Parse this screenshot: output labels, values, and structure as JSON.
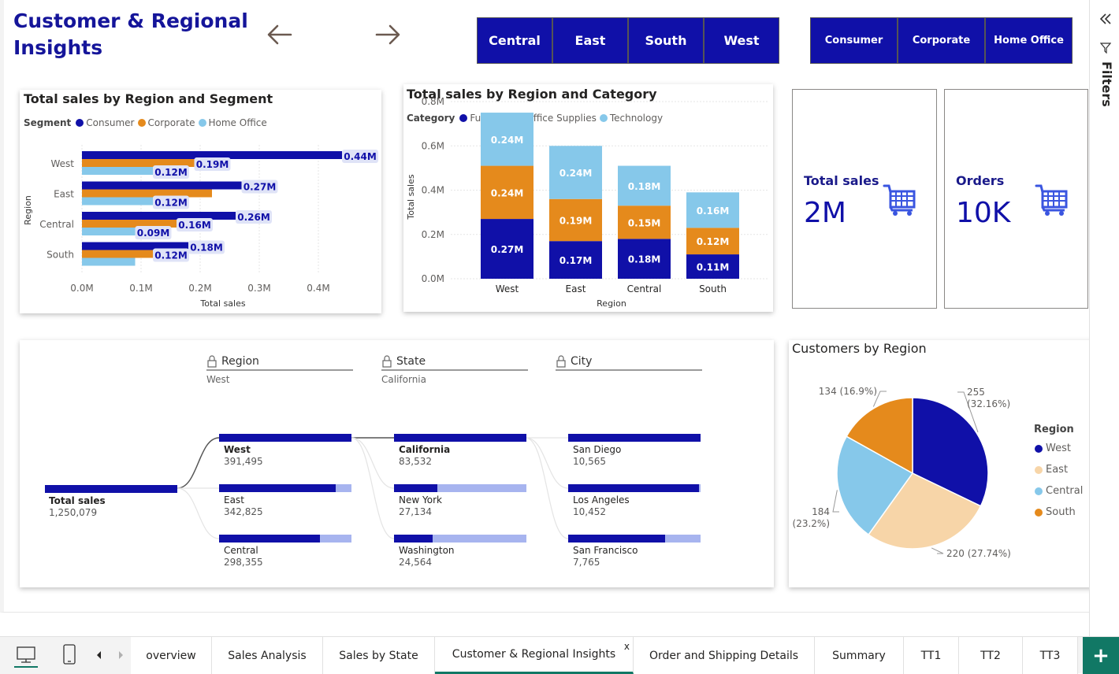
{
  "page": {
    "title": "Customer & Regional Insights"
  },
  "nav": {
    "back": "arrow-left-icon",
    "forward": "arrow-right-icon"
  },
  "region_slicer": [
    "Central",
    "East",
    "South",
    "West"
  ],
  "segment_slicer": [
    "Consumer",
    "Corporate",
    "Home Office"
  ],
  "colors": {
    "navy": "#1010a8",
    "orange": "#e58a1c",
    "light_blue": "#86c8ea",
    "peach": "#f7d5a8",
    "teal_accent": "#117865"
  },
  "segment_chart": {
    "title": "Total sales by Region and Segment",
    "legend_title": "Segment",
    "chart_data": {
      "type": "bar",
      "orientation": "horizontal",
      "categories": [
        "West",
        "East",
        "Central",
        "South"
      ],
      "series": [
        {
          "name": "Consumer",
          "values": [
            0.44,
            0.27,
            0.26,
            0.18
          ],
          "labels": [
            "0.44M",
            "0.27M",
            "0.26M",
            "0.18M"
          ]
        },
        {
          "name": "Corporate",
          "values": [
            0.19,
            0.22,
            0.16,
            0.12
          ],
          "labels": [
            "0.19M",
            "",
            "0.16M",
            "0.12M"
          ]
        },
        {
          "name": "Home Office",
          "values": [
            0.12,
            0.12,
            0.09,
            0.09
          ],
          "labels": [
            "0.12M",
            "0.12M",
            "0.09M",
            ""
          ]
        }
      ],
      "xlabel": "Total sales",
      "ylabel": "Region",
      "xticks": [
        "0.0M",
        "0.1M",
        "0.2M",
        "0.3M",
        "0.4M"
      ],
      "xlim": [
        0,
        0.45
      ]
    }
  },
  "category_chart": {
    "title": "Total sales by Region and Category",
    "legend_title": "Category",
    "chart_data": {
      "type": "bar",
      "stacked": true,
      "categories": [
        "West",
        "East",
        "Central",
        "South"
      ],
      "series": [
        {
          "name": "Furniture",
          "values": [
            0.27,
            0.17,
            0.18,
            0.11
          ],
          "labels": [
            "0.27M",
            "0.17M",
            "0.18M",
            "0.11M"
          ]
        },
        {
          "name": "Office Supplies",
          "values": [
            0.24,
            0.19,
            0.15,
            0.12
          ],
          "labels": [
            "0.24M",
            "0.19M",
            "0.15M",
            "0.12M"
          ]
        },
        {
          "name": "Technology",
          "values": [
            0.24,
            0.24,
            0.18,
            0.16
          ],
          "labels": [
            "0.24M",
            "0.24M",
            "0.18M",
            "0.16M"
          ]
        }
      ],
      "xlabel": "Region",
      "ylabel": "Total sales",
      "yticks": [
        "0.0M",
        "0.2M",
        "0.4M",
        "0.6M",
        "0.8M"
      ],
      "ylim": [
        0,
        0.8
      ]
    }
  },
  "kpis": [
    {
      "label": "Total sales",
      "value": "2M",
      "icon": "shopping-cart-icon"
    },
    {
      "label": "Orders",
      "value": "10K",
      "icon": "shopping-cart-icon"
    }
  ],
  "decomp_tree": {
    "levels": [
      {
        "header": "Region",
        "selected": "West"
      },
      {
        "header": "State",
        "selected": "California"
      },
      {
        "header": "City",
        "selected": ""
      }
    ],
    "root": {
      "name": "Total sales",
      "value": "1,250,079"
    },
    "regions": [
      {
        "name": "West",
        "value": "391,495",
        "fill": 1.0
      },
      {
        "name": "East",
        "value": "342,825",
        "fill": 0.88
      },
      {
        "name": "Central",
        "value": "298,355",
        "fill": 0.76
      }
    ],
    "states": [
      {
        "name": "California",
        "value": "83,532",
        "fill": 1.0
      },
      {
        "name": "New York",
        "value": "27,134",
        "fill": 0.33
      },
      {
        "name": "Washington",
        "value": "24,564",
        "fill": 0.29
      }
    ],
    "cities": [
      {
        "name": "San Diego",
        "value": "10,565",
        "fill": 1.0
      },
      {
        "name": "Los Angeles",
        "value": "10,452",
        "fill": 0.99
      },
      {
        "name": "San Francisco",
        "value": "7,765",
        "fill": 0.73
      }
    ]
  },
  "pie_chart": {
    "title": "Customers by Region",
    "legend_title": "Region",
    "chart_data": {
      "type": "pie",
      "categories": [
        "West",
        "East",
        "Central",
        "South"
      ],
      "values": [
        255,
        220,
        184,
        134
      ],
      "labels": [
        "255 (32.16%)",
        "220 (27.74%)",
        "184 (23.2%)",
        "134 (16.9%)"
      ],
      "colors": [
        "#1010a8",
        "#f7d5a8",
        "#86c8ea",
        "#e58a1c"
      ]
    }
  },
  "sidebar": {
    "collapse_icon": "double-chevron-left-icon",
    "filter_icon": "filter-icon",
    "label": "Filters"
  },
  "tabs": [
    {
      "label": "overview"
    },
    {
      "label": "Sales Analysis"
    },
    {
      "label": "Sales by State"
    },
    {
      "label": "Customer & Regional Insights",
      "active": true
    },
    {
      "label": "Order and Shipping Details"
    },
    {
      "label": "Summary"
    },
    {
      "label": "TT1"
    },
    {
      "label": "TT2"
    },
    {
      "label": "TT3"
    }
  ],
  "tab_close": "x",
  "add_page": "+"
}
